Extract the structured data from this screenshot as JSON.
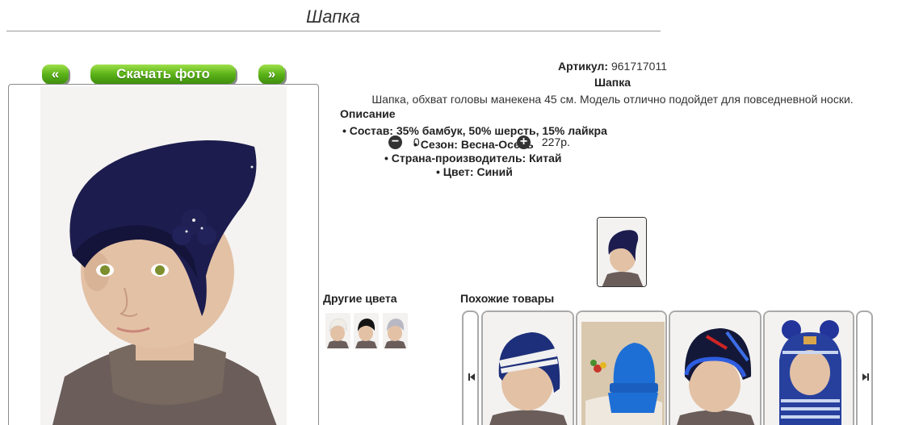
{
  "page": {
    "title": "Шапка"
  },
  "gallery": {
    "prev_label": "«",
    "download_label": "Скачать фото",
    "next_label": "»"
  },
  "product": {
    "article_label": "Артикул:",
    "article_value": "961717011",
    "name": "Шапка",
    "description": "Шапка, обхват головы манекена 45 см. Модель отлично подойдет для повседневной носки.",
    "description_heading": "Описание",
    "properties": [
      "Состав: 35% бамбук, 50% шерсть, 15% лайкра",
      "Сезон: Весна-Осень",
      "Страна-производитель: Китай",
      "Цвет: Синий"
    ]
  },
  "cart": {
    "minus_icon": "−",
    "quantity": "0",
    "plus_icon": "+",
    "price": "227р."
  },
  "sections": {
    "other_colors": "Другие цвета",
    "similar": "Похожие товары"
  },
  "other_colors": [
    "white",
    "black",
    "grey"
  ],
  "similar_items": [
    "striped-hat",
    "blue-hat-fur",
    "skate-hat",
    "balaclava-pompom"
  ],
  "colors": {
    "button_green": "#5cb319",
    "hat_navy": "#1c1c4e",
    "sweater": "#6b5e5a",
    "skin": "#e3c1a5"
  }
}
